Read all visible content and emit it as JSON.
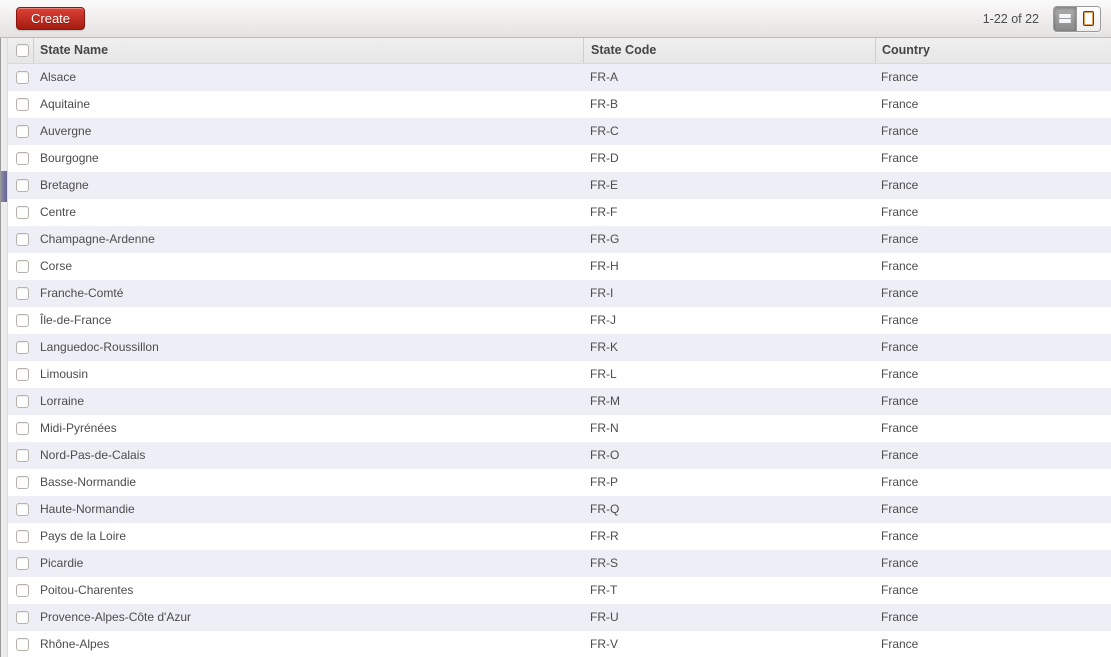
{
  "toolbar": {
    "create_label": "Create",
    "pager": "1-22 of 22",
    "icons": {
      "list_view": "list-lines-icon",
      "form_view": "page-outline-icon"
    }
  },
  "colors": {
    "create_button_top": "#dd4036",
    "create_button_bottom": "#a41c10",
    "row_stripe": "#eeeef6",
    "menu_highlight": "#64648f"
  },
  "table": {
    "columns": [
      {
        "label": "State Name"
      },
      {
        "label": "State Code"
      },
      {
        "label": "Country"
      }
    ],
    "rows": [
      {
        "name": "Alsace",
        "code": "FR-A",
        "country": "France"
      },
      {
        "name": "Aquitaine",
        "code": "FR-B",
        "country": "France"
      },
      {
        "name": "Auvergne",
        "code": "FR-C",
        "country": "France"
      },
      {
        "name": "Bourgogne",
        "code": "FR-D",
        "country": "France"
      },
      {
        "name": "Bretagne",
        "code": "FR-E",
        "country": "France"
      },
      {
        "name": "Centre",
        "code": "FR-F",
        "country": "France"
      },
      {
        "name": "Champagne-Ardenne",
        "code": "FR-G",
        "country": "France"
      },
      {
        "name": "Corse",
        "code": "FR-H",
        "country": "France"
      },
      {
        "name": "Franche-Comté",
        "code": "FR-I",
        "country": "France"
      },
      {
        "name": "Île-de-France",
        "code": "FR-J",
        "country": "France"
      },
      {
        "name": "Languedoc-Roussillon",
        "code": "FR-K",
        "country": "France"
      },
      {
        "name": "Limousin",
        "code": "FR-L",
        "country": "France"
      },
      {
        "name": "Lorraine",
        "code": "FR-M",
        "country": "France"
      },
      {
        "name": "Midi-Pyrénées",
        "code": "FR-N",
        "country": "France"
      },
      {
        "name": "Nord-Pas-de-Calais",
        "code": "FR-O",
        "country": "France"
      },
      {
        "name": "Basse-Normandie",
        "code": "FR-P",
        "country": "France"
      },
      {
        "name": "Haute-Normandie",
        "code": "FR-Q",
        "country": "France"
      },
      {
        "name": "Pays de la Loire",
        "code": "FR-R",
        "country": "France"
      },
      {
        "name": "Picardie",
        "code": "FR-S",
        "country": "France"
      },
      {
        "name": "Poitou-Charentes",
        "code": "FR-T",
        "country": "France"
      },
      {
        "name": "Provence-Alpes-Côte d'Azur",
        "code": "FR-U",
        "country": "France"
      },
      {
        "name": "Rhône-Alpes",
        "code": "FR-V",
        "country": "France"
      }
    ]
  }
}
